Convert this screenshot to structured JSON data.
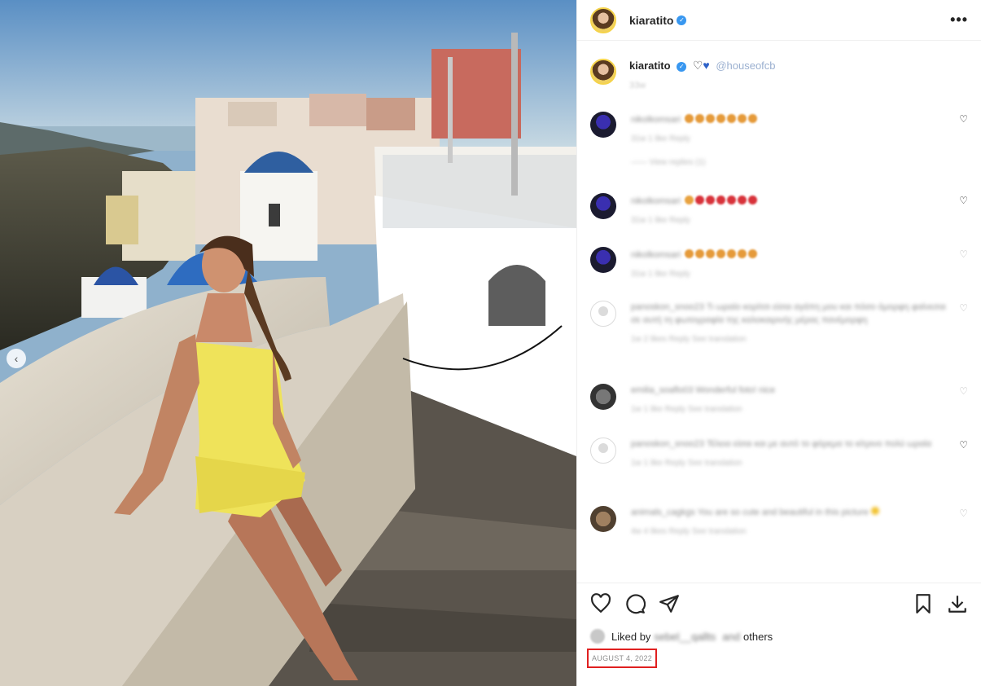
{
  "post": {
    "username": "kiaratito",
    "more_label": "•••",
    "prev_label": "‹"
  },
  "caption": {
    "username": "kiaratito",
    "mention": "@houseofcb",
    "age": "33w"
  },
  "comments": [
    {
      "user": "nikolkomsari",
      "text": "",
      "meta": "31w  1 like  Reply",
      "emoji": "orange",
      "view_replies": "—— View replies (1)"
    },
    {
      "user": "nikolkomsari",
      "text": "",
      "meta": "31w  1 like  Reply",
      "emoji": "red"
    },
    {
      "user": "nikolkomsari",
      "text": "",
      "meta": "31w  1 like  Reply",
      "emoji": "orange"
    },
    {
      "user": "panoskon_snoo23",
      "text": "Τι ωραίο κορίτσι είσαι αγάπη μου και πόσο όμορφη φαίνεσαι σε αυτή τη φωτογραφία της καλοκαιρινής μέρας πανέμορφη",
      "meta": "1w  2 likes  Reply  See translation"
    },
    {
      "user": "emilia_soaflo03",
      "text": "Wonderful foto! nice",
      "meta": "1w  1 like  Reply  See translation"
    },
    {
      "user": "panoskon_snoo23",
      "text": "Τέλεια είσαι και με αυτό το φόρεμα το κίτρινο πολύ ωραία",
      "meta": "1w  1 like  Reply  See translation"
    },
    {
      "user": "animals_cagkgs",
      "text": "You are so cute and beautiful in this picture",
      "meta": "4w  4 likes  Reply  See translation"
    }
  ],
  "likes": {
    "prefix": "Liked by",
    "user": "sebel__qallts",
    "and": "and",
    "others": "others"
  },
  "date": "AUGUST 4, 2022",
  "colors": {
    "accent_blue": "#3897f0",
    "highlight_red": "#e02020"
  },
  "icons": [
    "heart-icon",
    "comment-icon",
    "share-icon",
    "bookmark-icon",
    "download-icon"
  ]
}
